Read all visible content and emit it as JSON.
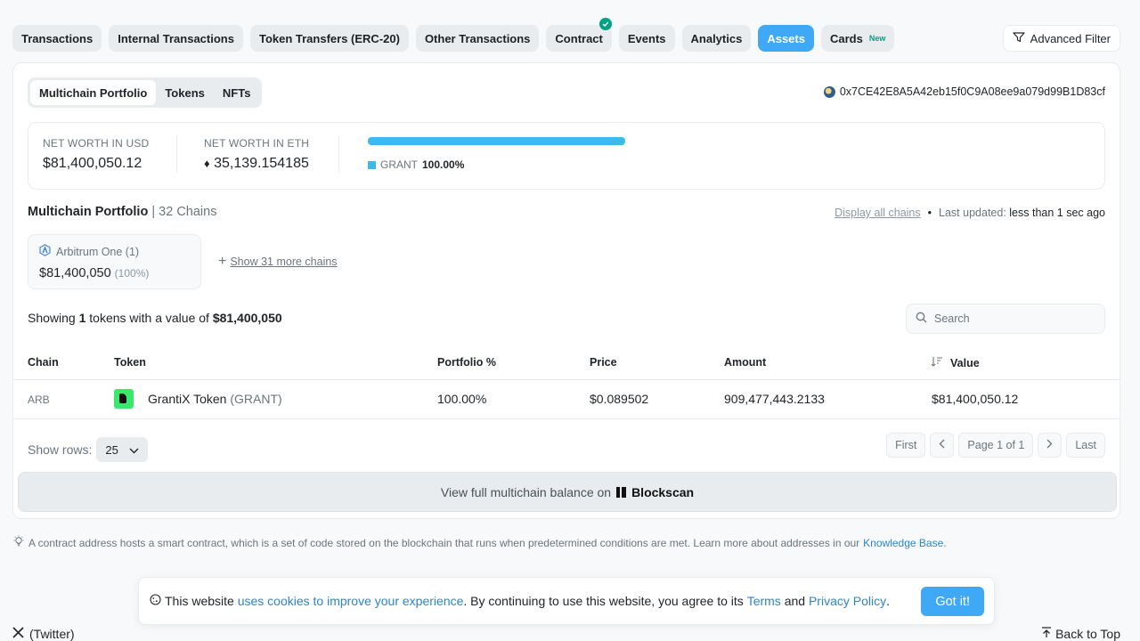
{
  "tabs": [
    {
      "label": "Transactions"
    },
    {
      "label": "Internal Transactions"
    },
    {
      "label": "Token Transfers (ERC-20)"
    },
    {
      "label": "Other Transactions"
    },
    {
      "label": "Contract"
    },
    {
      "label": "Events"
    },
    {
      "label": "Analytics"
    },
    {
      "label": "Assets"
    },
    {
      "label": "Cards",
      "badge": "New"
    }
  ],
  "advanced_filter": "Advanced Filter",
  "subtabs": [
    "Multichain Portfolio",
    "Tokens",
    "NFTs"
  ],
  "address": "0x7CE42E8A5A42eb15f0C9A08ee9a079d99B1D83cf",
  "networth": {
    "usd_label": "NET WORTH IN USD",
    "usd_value": "$81,400,050.12",
    "eth_label": "NET WORTH IN ETH",
    "eth_symbol": "♦",
    "eth_value": "35,139.154185",
    "allocation_token": "GRANT",
    "allocation_pct": "100.00%",
    "bar_color": "#3fb8ee"
  },
  "portfolio": {
    "title": "Multichain Portfolio",
    "chains_count": "32 Chains",
    "display_all": "Display all chains",
    "last_updated_label": "Last updated:",
    "last_updated_value": "less than 1 sec ago",
    "chain_name": "Arbitrum One (1)",
    "chain_value": "$81,400,050",
    "chain_pct": "(100%)",
    "show_more": "Show 31 more chains"
  },
  "showing": {
    "prefix": "Showing",
    "count": "1",
    "middle": "tokens with a value of",
    "value": "$81,400,050"
  },
  "search": {
    "placeholder": "Search"
  },
  "table": {
    "headers": [
      "Chain",
      "Token",
      "Portfolio %",
      "Price",
      "Amount",
      "Value"
    ],
    "row": {
      "chain": "ARB",
      "token": "GrantiX Token",
      "symbol": "(GRANT)",
      "portfolio": "100.00%",
      "price": "$0.089502",
      "amount": "909,477,443.2133",
      "value": "$81,400,050.12"
    }
  },
  "pagination": {
    "rows_label": "Show rows:",
    "rows_value": "25",
    "first": "First",
    "page_info": "Page 1 of 1",
    "last": "Last"
  },
  "blockscan": {
    "text": "View full multichain balance on",
    "brand": "Blockscan"
  },
  "footer_note": {
    "text": "A contract address hosts a smart contract, which is a set of code stored on the blockchain that runs when predetermined conditions are met. Learn more about addresses in our",
    "link": "Knowledge Base",
    "end": "."
  },
  "cookie": {
    "t1": "This website",
    "l1": "uses cookies to improve your experience",
    "t2": ". By continuing to use this website, you agree to its",
    "l2": "Terms",
    "t3": "and",
    "l3": "Privacy Policy",
    "t4": ".",
    "button": "Got it!"
  },
  "bottom": {
    "twitter": "(Twitter)",
    "back_to_top": "Back to Top"
  },
  "colors": {
    "accent": "#3fa9f5",
    "success": "#00a186",
    "link": "#2d86c8"
  }
}
